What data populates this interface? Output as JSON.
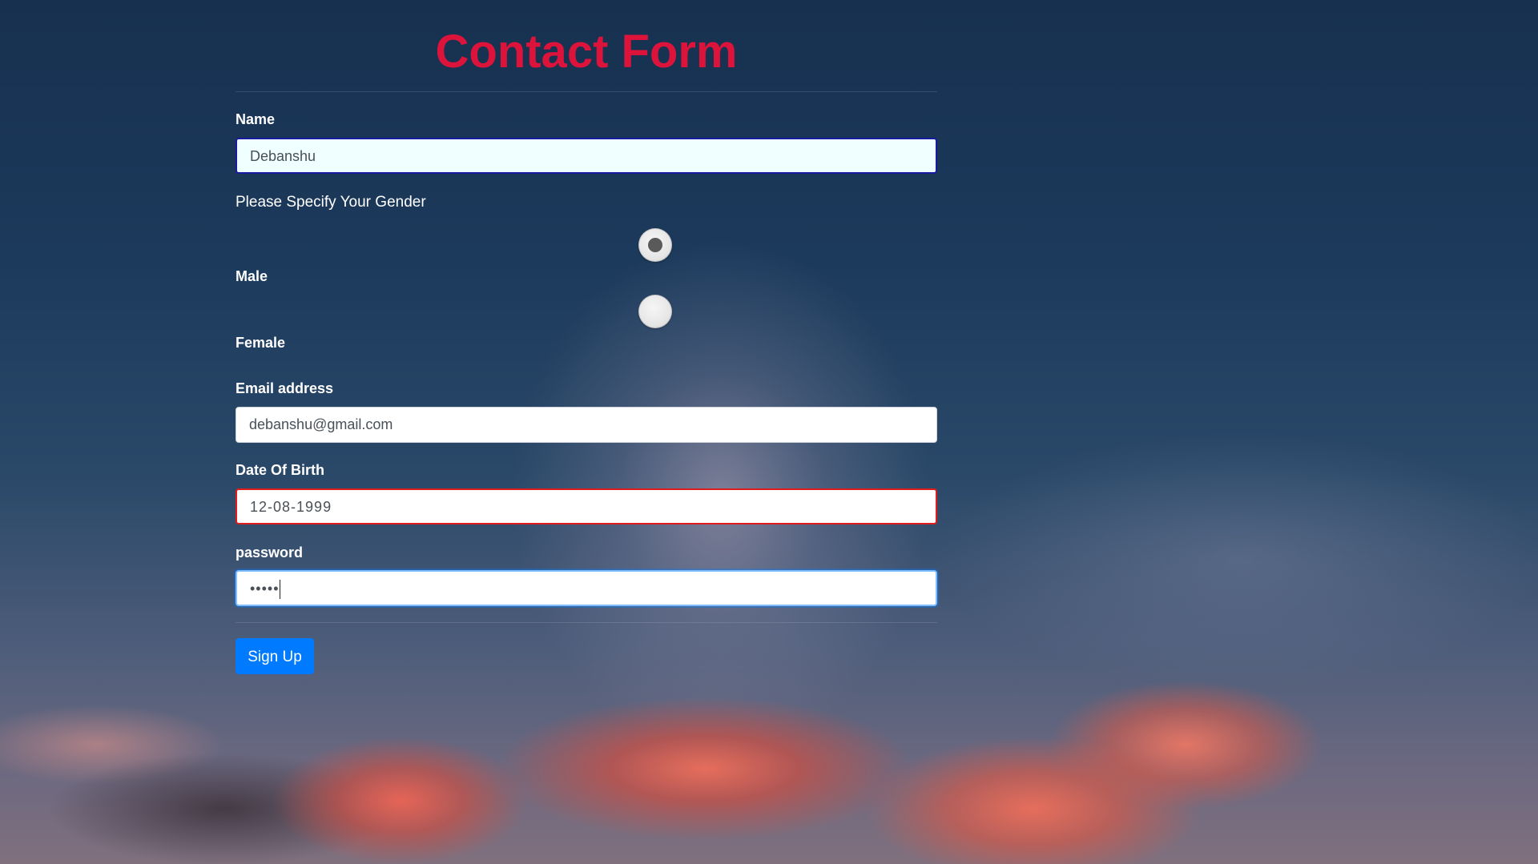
{
  "form": {
    "title": "Contact Form",
    "name": {
      "label": "Name",
      "value": "Debanshu"
    },
    "gender": {
      "prompt": "Please Specify Your Gender",
      "options": [
        {
          "label": "Male",
          "selected": true
        },
        {
          "label": "Female",
          "selected": false
        }
      ]
    },
    "email": {
      "label": "Email address",
      "value": "debanshu@gmail.com"
    },
    "dob": {
      "label": "Date Of Birth",
      "value": "12-08-1999"
    },
    "password": {
      "label": "password",
      "masked_value": "•••••"
    },
    "submit_label": "Sign Up"
  },
  "colors": {
    "title": "#dc143c",
    "button": "#007bff",
    "dob_border": "#e01b1b",
    "name_border": "#1a1aa0",
    "password_focus": "#80bdff"
  }
}
